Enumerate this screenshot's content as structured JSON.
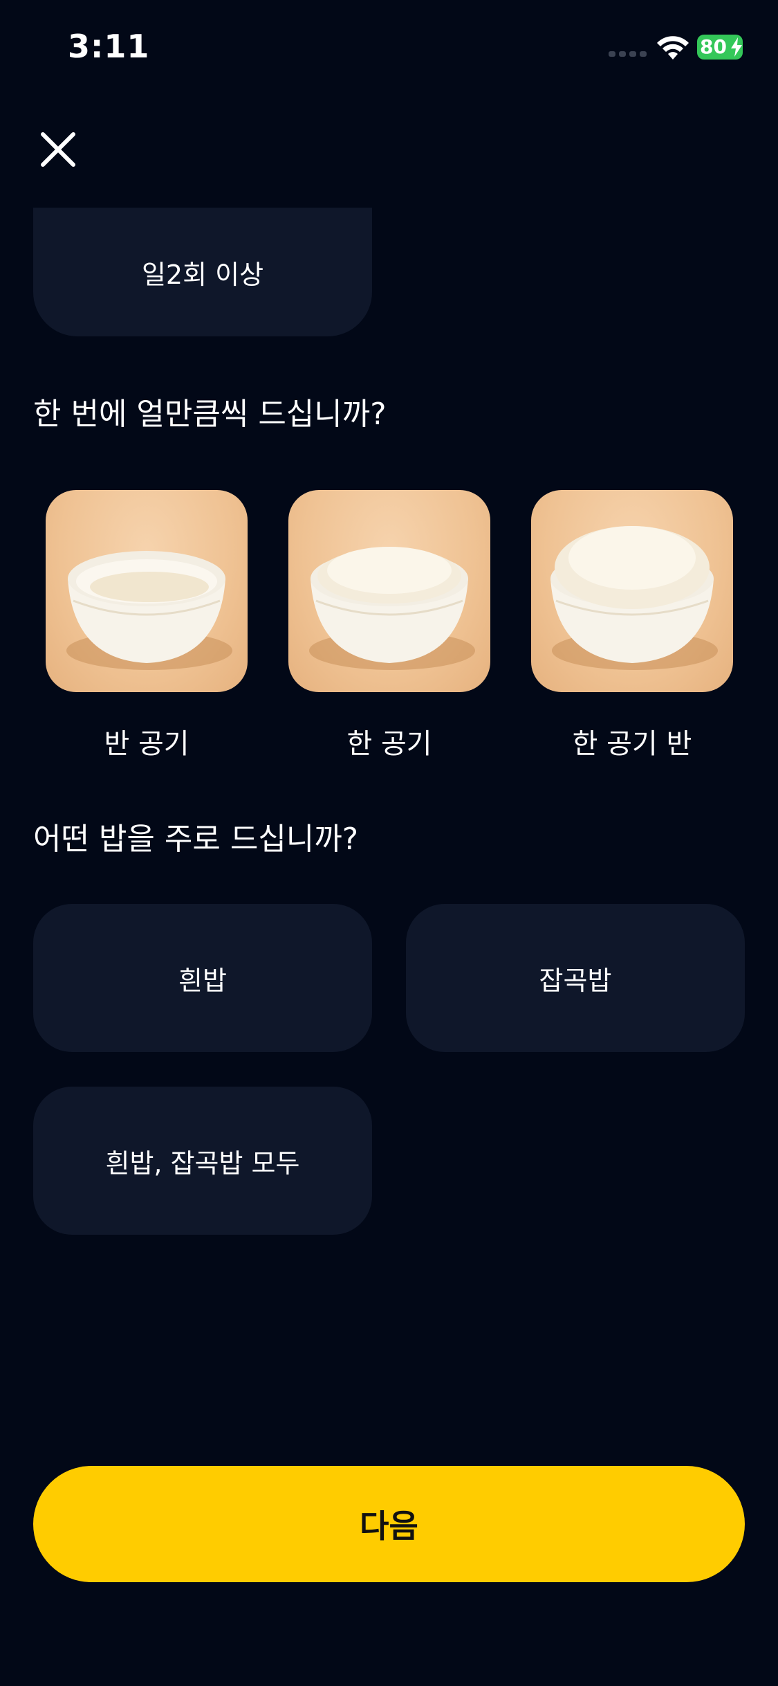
{
  "status_bar": {
    "time": "3:11",
    "battery": "80"
  },
  "frequency": {
    "option_partial": "일2회 이상"
  },
  "amount": {
    "question": "한 번에 얼만큼씩 드십니까?",
    "options": [
      {
        "label": "반 공기"
      },
      {
        "label": "한 공기"
      },
      {
        "label": "한 공기 반"
      }
    ]
  },
  "rice_type": {
    "question": "어떤 밥을 주로 드십니까?",
    "options": [
      {
        "label": "흰밥"
      },
      {
        "label": "잡곡밥"
      },
      {
        "label": "흰밥, 잡곡밥 모두"
      }
    ]
  },
  "next_button": {
    "label": "다음"
  },
  "colors": {
    "background": "#020817",
    "card": "#0f172a",
    "accent": "#ffcc00",
    "battery": "#34c759"
  },
  "icons": [
    "close-icon",
    "wifi-icon",
    "signal-icon",
    "battery-icon"
  ]
}
